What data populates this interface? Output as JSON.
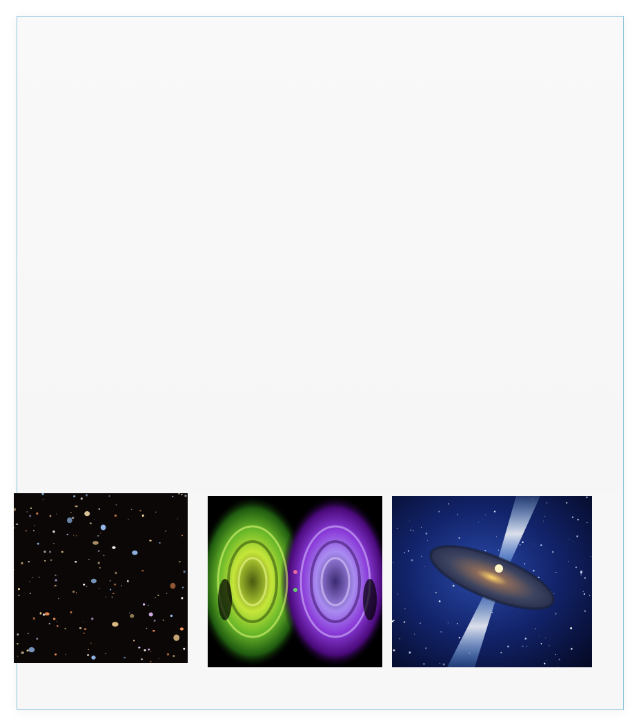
{
  "gallery": {
    "images": [
      {
        "name": "hubble-deep-field-image"
      },
      {
        "name": "colorful-wormhole-image"
      },
      {
        "name": "quasar-jet-image"
      }
    ]
  }
}
